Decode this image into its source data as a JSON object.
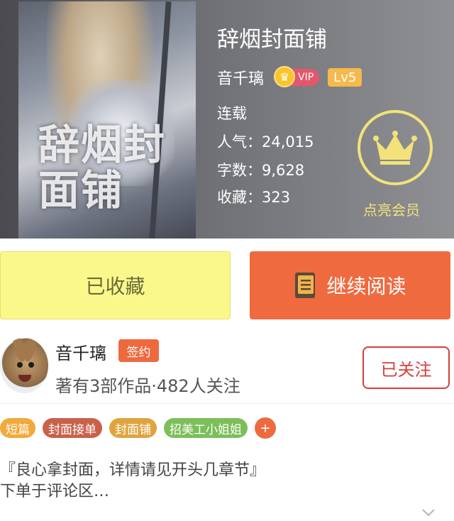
{
  "book": {
    "cover_title": "辞烟封面铺",
    "title": "辞烟封面铺",
    "author": "音千璃",
    "vip_label": "VIP",
    "level": "Lv5",
    "status": "连载",
    "popularity": "人气：24,015",
    "words": "字数：9,628",
    "favorites": "收藏：323"
  },
  "member": {
    "label": "点亮会员",
    "icon": "crown-icon",
    "color": "#f3e27a"
  },
  "actions": {
    "collected_label": "已收藏",
    "read_label": "继续阅读"
  },
  "author_section": {
    "name": "音千璃",
    "sign_badge": "签约",
    "stats": "著有3部作品·482人关注",
    "follow_label": "已关注"
  },
  "tags": [
    {
      "label": "短篇",
      "color": "#f2a93b"
    },
    {
      "label": "封面接单",
      "color": "#c9614a"
    },
    {
      "label": "封面铺",
      "color": "#e0a43f"
    },
    {
      "label": "招美工小姐姐",
      "color": "#7cbf5a"
    }
  ],
  "tag_add_label": "+",
  "description": {
    "line1": "『良心拿封面，详情请见开头几章节』",
    "line2": "下单于评论区…"
  },
  "colors": {
    "accent": "#ef6a3f",
    "collected_bg": "#fbf88b",
    "follow": "#d83d3d"
  }
}
